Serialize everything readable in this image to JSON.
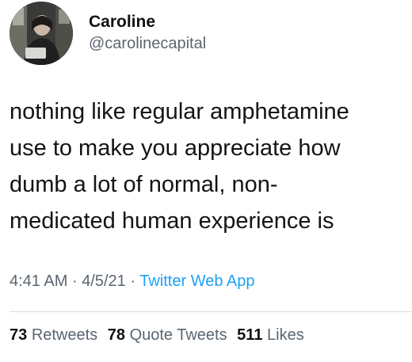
{
  "author": {
    "name": "Caroline",
    "handle": "@carolinecapital"
  },
  "tweet": {
    "lines": [
      "nothing like regular amphetamine",
      "use to make you appreciate how",
      "dumb a lot of normal, non-",
      "medicated human experience is"
    ],
    "time": "4:41 AM",
    "separator": "·",
    "date": "4/5/21",
    "source": "Twitter Web App"
  },
  "stats": {
    "retweets_count": "73",
    "retweets_label": "Retweets",
    "quote_count": "78",
    "quote_label": "Quote Tweets",
    "likes_count": "511",
    "likes_label": "Likes"
  },
  "colors": {
    "link": "#1da1f2",
    "secondary_text": "#5b6670"
  }
}
